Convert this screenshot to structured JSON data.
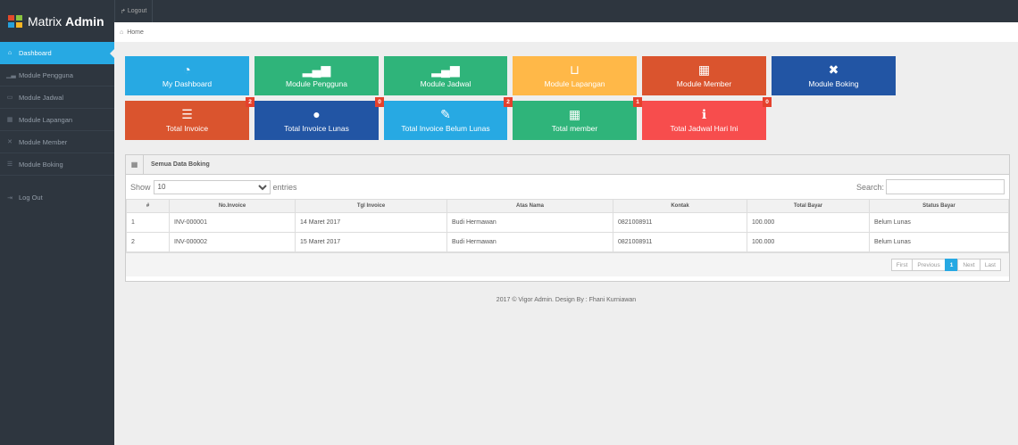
{
  "brand": {
    "name_thin": "Matrix",
    "name_bold": "Admin",
    "logo_colors": [
      "#e24a2b",
      "#8ac440",
      "#26a0da",
      "#f7b523"
    ]
  },
  "topbar": {
    "logout_label": "Logout"
  },
  "breadcrumb": {
    "home_label": "Home"
  },
  "sidebar": {
    "items": [
      {
        "label": "Dashboard",
        "icon": "home-icon",
        "glyph": "⌂"
      },
      {
        "label": "Module Pengguna",
        "icon": "signal-icon",
        "glyph": "▁▃"
      },
      {
        "label": "Module Jadwal",
        "icon": "inbox-icon",
        "glyph": "▭"
      },
      {
        "label": "Module Lapangan",
        "icon": "grid-icon",
        "glyph": "▦"
      },
      {
        "label": "Module Member",
        "icon": "fullscreen-icon",
        "glyph": "✕"
      },
      {
        "label": "Module Boking",
        "icon": "list-icon",
        "glyph": "☰"
      }
    ],
    "logout": {
      "label": "Log Out",
      "glyph": "⇥"
    }
  },
  "tiles": [
    {
      "label": "My Dashboard",
      "icon": "dashboard-icon",
      "glyph": "◔",
      "color": "#27a9e3",
      "badge": ""
    },
    {
      "label": "Module Pengguna",
      "icon": "signal-icon",
      "glyph": "▂▄▆",
      "color": "#28b779",
      "badge": ""
    },
    {
      "label": "Module Jadwal",
      "icon": "signal-icon",
      "glyph": "▂▄▆",
      "color": "#28b779",
      "badge": ""
    },
    {
      "label": "Module Lapangan",
      "icon": "inbox-icon",
      "glyph": "⊔",
      "color": "#ffb848",
      "badge": ""
    },
    {
      "label": "Module Member",
      "icon": "th-icon",
      "glyph": "▦",
      "color": "#da542e",
      "badge": ""
    },
    {
      "label": "Module Boking",
      "icon": "fullscreen-icon",
      "glyph": "✖",
      "color": "#2255a4",
      "badge": ""
    },
    {
      "label": "Total Invoice",
      "icon": "list-icon",
      "glyph": "☰",
      "color": "#da542e",
      "badge": "2"
    },
    {
      "label": "Total Invoice Lunas",
      "icon": "tint-icon",
      "glyph": "●",
      "color": "#2255a4",
      "badge": "0"
    },
    {
      "label": "Total Invoice Belum Lunas",
      "icon": "pencil-icon",
      "glyph": "✎",
      "color": "#27a9e3",
      "badge": "2"
    },
    {
      "label": "Total member",
      "icon": "calendar-icon",
      "glyph": "▦",
      "color": "#28b779",
      "badge": "1"
    },
    {
      "label": "Total Jadwal Hari Ini",
      "icon": "info-icon",
      "glyph": "ℹ",
      "color": "#f74d4d",
      "badge": "0"
    }
  ],
  "table_widget": {
    "title": "Semua Data Boking",
    "show_label": "Show",
    "entries_value": "10",
    "entries_label": "entries",
    "search_label": "Search:",
    "columns": [
      "#",
      "No.Invoice",
      "Tgl Invoice",
      "Atas Nama",
      "Kontak",
      "Total Bayar",
      "Status Bayar"
    ],
    "rows": [
      [
        "1",
        "INV-000001",
        "14 Maret 2017",
        "Budi Hermawan",
        "0821008911",
        "100.000",
        "Belum Lunas"
      ],
      [
        "2",
        "INV-000002",
        "15 Maret 2017",
        "Budi Hermawan",
        "0821008911",
        "100.000",
        "Belum Lunas"
      ]
    ],
    "pagination": {
      "first": "First",
      "previous": "Previous",
      "current": "1",
      "next": "Next",
      "last": "Last"
    }
  },
  "footer": {
    "text": "2017 © Vigor Admin. Design By : Fhani Kurniawan"
  }
}
